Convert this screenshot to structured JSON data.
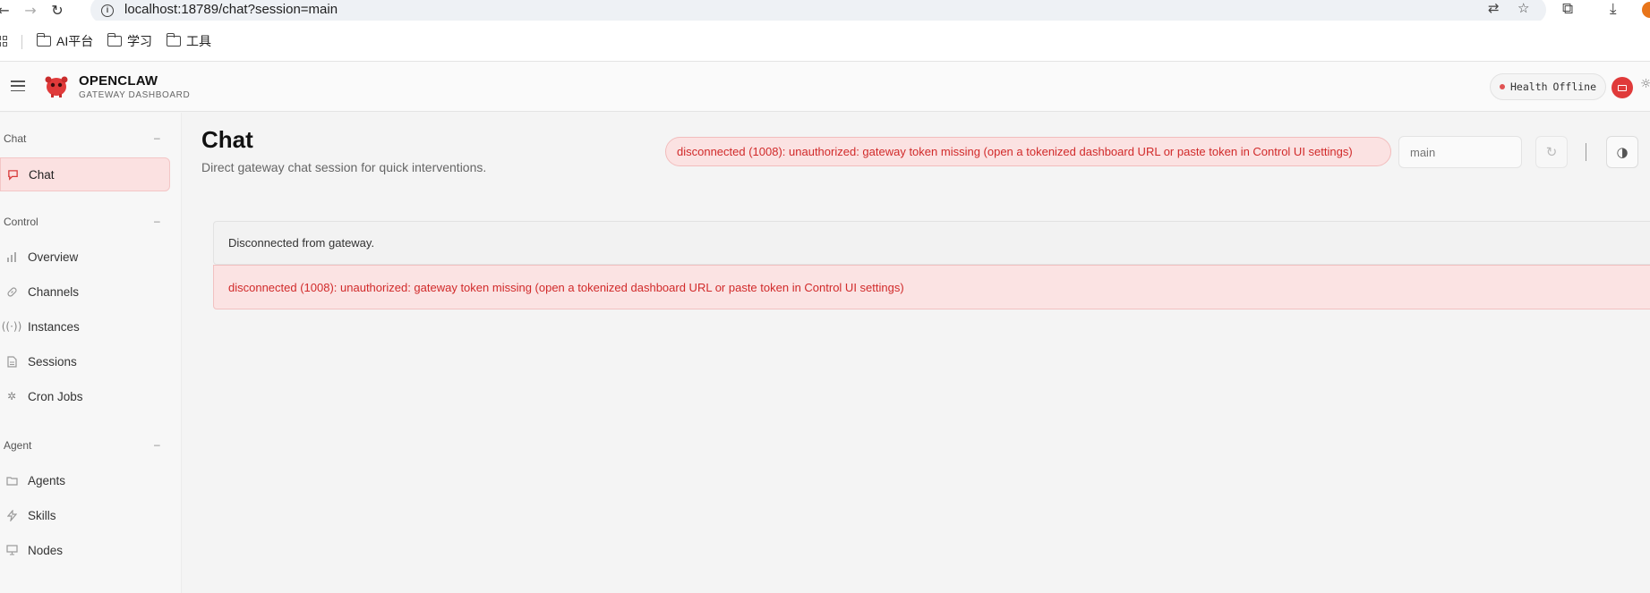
{
  "browser": {
    "url": "localhost:18789/chat?session=main",
    "bookmarks": [
      {
        "label": "AI平台"
      },
      {
        "label": "学习"
      },
      {
        "label": "工具"
      }
    ]
  },
  "header": {
    "brand_name": "OPENCLAW",
    "brand_sub": "GATEWAY DASHBOARD",
    "health_label": "Health",
    "health_status": "Offline"
  },
  "sidebar": {
    "sections": [
      {
        "label": "Chat",
        "collapse": "–",
        "items": [
          {
            "label": "Chat",
            "icon": "message-icon",
            "active": true
          }
        ]
      },
      {
        "label": "Control",
        "collapse": "–",
        "items": [
          {
            "label": "Overview",
            "icon": "bar-chart-icon"
          },
          {
            "label": "Channels",
            "icon": "link-icon"
          },
          {
            "label": "Instances",
            "icon": "radio-icon"
          },
          {
            "label": "Sessions",
            "icon": "file-icon"
          },
          {
            "label": "Cron Jobs",
            "icon": "loader-icon"
          }
        ]
      },
      {
        "label": "Agent",
        "collapse": "–",
        "items": [
          {
            "label": "Agents",
            "icon": "folder-icon"
          },
          {
            "label": "Skills",
            "icon": "zap-icon"
          },
          {
            "label": "Nodes",
            "icon": "monitor-icon"
          }
        ]
      }
    ]
  },
  "main": {
    "title": "Chat",
    "subtitle": "Direct gateway chat session for quick interventions.",
    "error_pill": "disconnected (1008): unauthorized: gateway token missing (open a tokenized dashboard URL or paste token in Control UI settings)",
    "session_placeholder": "main",
    "notice": "Disconnected from gateway.",
    "notice_error": "disconnected (1008): unauthorized: gateway token missing (open a tokenized dashboard URL or paste token in Control UI settings)"
  },
  "colors": {
    "accent": "#e03a3a",
    "error_text": "#d12a2a",
    "error_bg": "#fbe2e2",
    "active_nav_bg": "#fbe1e1"
  }
}
